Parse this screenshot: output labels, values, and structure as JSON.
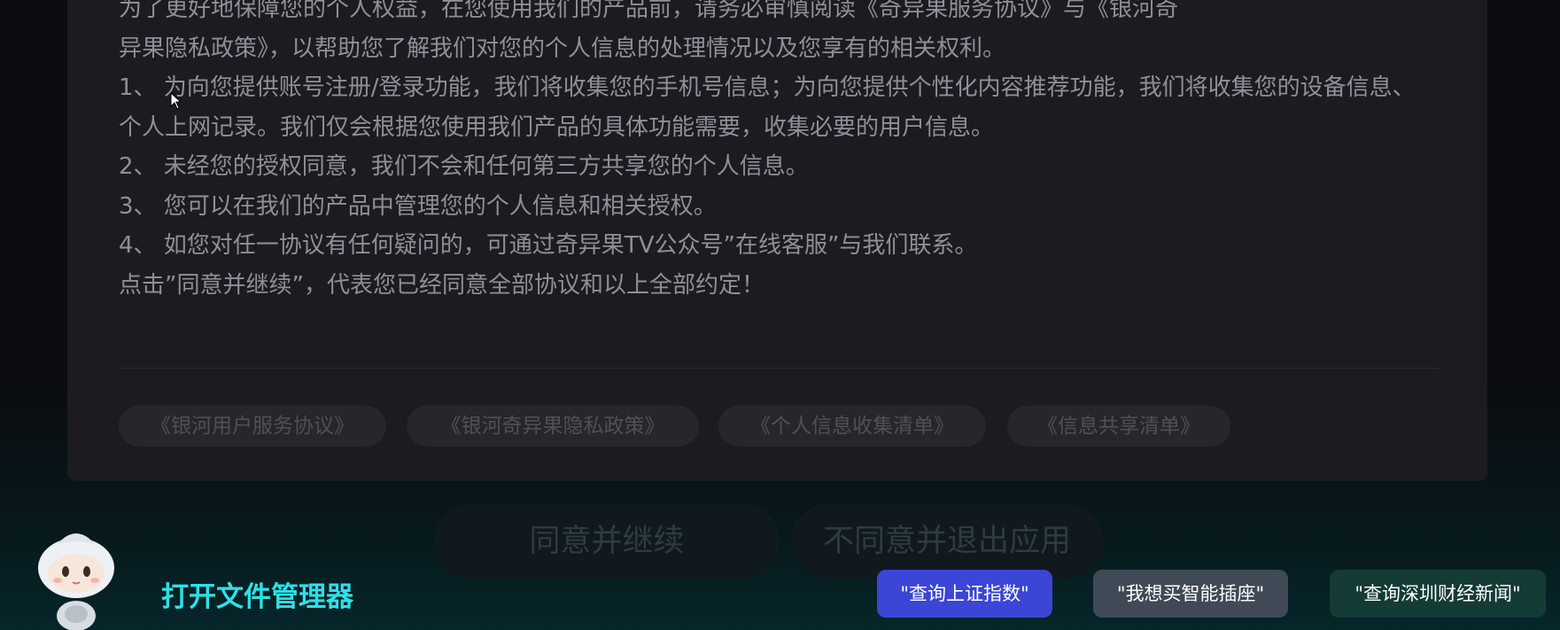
{
  "policy": {
    "lines": [
      "为了更好地保障您的个人权益，在您使用我们的产品前，请务必审慎阅读《奇异果服务协议》与《银河奇",
      "异果隐私政策》，以帮助您了解我们对您的个人信息的处理情况以及您享有的相关权利。",
      "1、 为向您提供账号注册/登录功能，我们将收集您的手机号信息；为向您提供个性化内容推荐功能，我们将收集您的设备信息、个人上网记录。我们仅会根据您使用我们产品的具体功能需要，收集必要的用户信息。",
      "2、 未经您的授权同意，我们不会和任何第三方共享您的个人信息。",
      "3、 您可以在我们的产品中管理您的个人信息和相关授权。",
      "4、 如您对任一协议有任何疑问的，可通过奇异果TV公众号”在线客服”与我们联系。",
      "点击”同意并继续”，代表您已经同意全部协议和以上全部约定！"
    ]
  },
  "links": [
    "《银河用户服务协议》",
    "《银河奇异果隐私政策》",
    "《个人信息收集清单》",
    "《信息共享清单》"
  ],
  "actions": {
    "agree": "同意并继续",
    "disagree": "不同意并退出应用"
  },
  "assistant": {
    "hint": "打开文件管理器",
    "suggestions": [
      "\"查询上证指数\"",
      "\"我想买智能插座\"",
      "\"查询深圳财经新闻\""
    ]
  },
  "colors": {
    "dialog_bg": "#1b1b21",
    "hint_text": "#2ee0e8",
    "chip_primary": "#3b45d6",
    "chip_secondary": "#3f4a56",
    "chip_tertiary": "#143b36"
  },
  "icons": {
    "assistant": "robot-assistant-icon",
    "cursor": "mouse-pointer-icon"
  }
}
